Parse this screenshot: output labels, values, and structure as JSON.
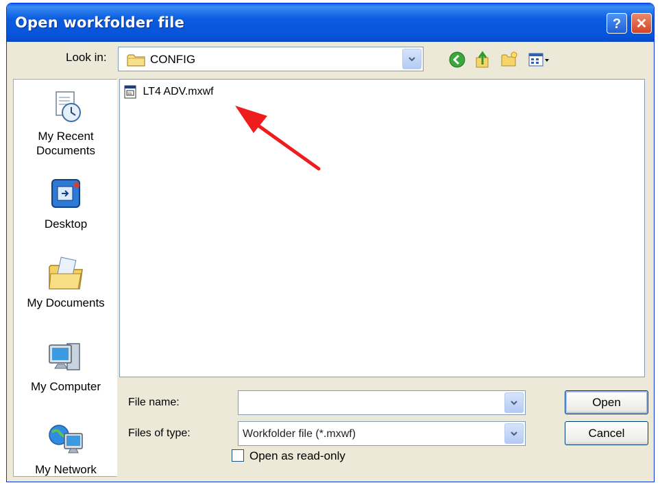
{
  "window": {
    "title": "Open workfolder file",
    "help_glyph": "?",
    "close_glyph": "✕"
  },
  "look_in": {
    "label": "Look in:",
    "value": "CONFIG"
  },
  "toolbar": {
    "icons": [
      "back-icon",
      "up-folder-icon",
      "new-folder-icon",
      "views-menu-icon"
    ]
  },
  "places": [
    {
      "label": "My Recent Documents",
      "icon": "recent-documents-icon"
    },
    {
      "label": "Desktop",
      "icon": "desktop-icon"
    },
    {
      "label": "My Documents",
      "icon": "my-documents-icon"
    },
    {
      "label": "My Computer",
      "icon": "my-computer-icon"
    },
    {
      "label": "My Network",
      "icon": "my-network-icon"
    }
  ],
  "files": [
    {
      "name": "LT4 ADV.mxwf",
      "icon": "workfolder-file-icon"
    }
  ],
  "file_name": {
    "label": "File name:",
    "value": ""
  },
  "file_type": {
    "label": "Files of type:",
    "value": "Workfolder file (*.mxwf)"
  },
  "read_only": {
    "label": "Open as read-only",
    "checked": false
  },
  "buttons": {
    "open": "Open",
    "cancel": "Cancel"
  },
  "colors": {
    "title_bar": "#0653d8",
    "annotation_arrow": "#ee1c1c",
    "dialog_bg": "#ece9d8"
  }
}
